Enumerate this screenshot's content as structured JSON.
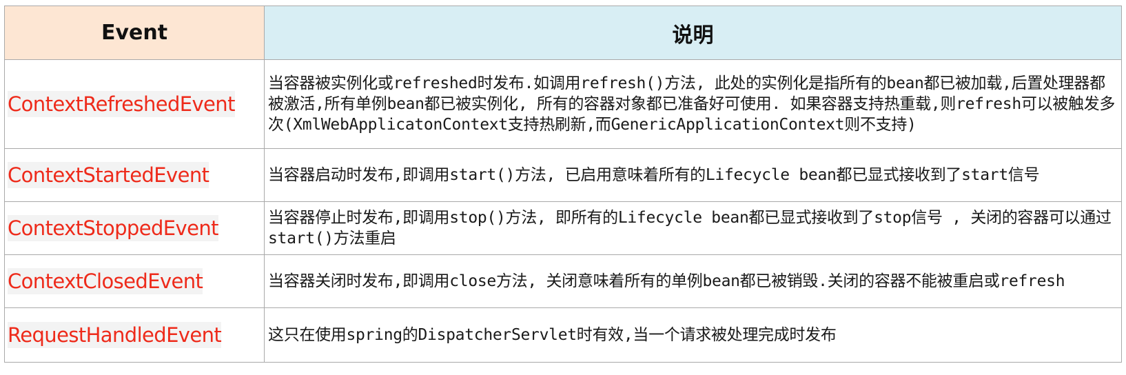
{
  "header": {
    "event": "Event",
    "description": "说明"
  },
  "rows": [
    {
      "event": "ContextRefreshedEvent",
      "description": "当容器被实例化或refreshed时发布.如调用refresh()方法, 此处的实例化是指所有的bean都已被加载,后置处理器都被激活,所有单例bean都已被实例化, 所有的容器对象都已准备好可使用. 如果容器支持热重载,则refresh可以被触发多次(XmlWebApplicatonContext支持热刷新,而GenericApplicationContext则不支持)"
    },
    {
      "event": "ContextStartedEvent",
      "description": "当容器启动时发布,即调用start()方法, 已启用意味着所有的Lifecycle bean都已显式接收到了start信号"
    },
    {
      "event": "ContextStoppedEvent",
      "description": "当容器停止时发布,即调用stop()方法, 即所有的Lifecycle bean都已显式接收到了stop信号 , 关闭的容器可以通过start()方法重启"
    },
    {
      "event": "ContextClosedEvent",
      "description": "当容器关闭时发布,即调用close方法, 关闭意味着所有的单例bean都已被销毁.关闭的容器不能被重启或refresh"
    },
    {
      "event": "RequestHandledEvent",
      "description": "这只在使用spring的DispatcherServlet时有效,当一个请求被处理完成时发布"
    }
  ],
  "colors": {
    "event_text": "#ee2a1a",
    "header_event_bg": "#fde6d3",
    "header_desc_bg": "#d8eef4",
    "border": "#a9a9a9"
  }
}
